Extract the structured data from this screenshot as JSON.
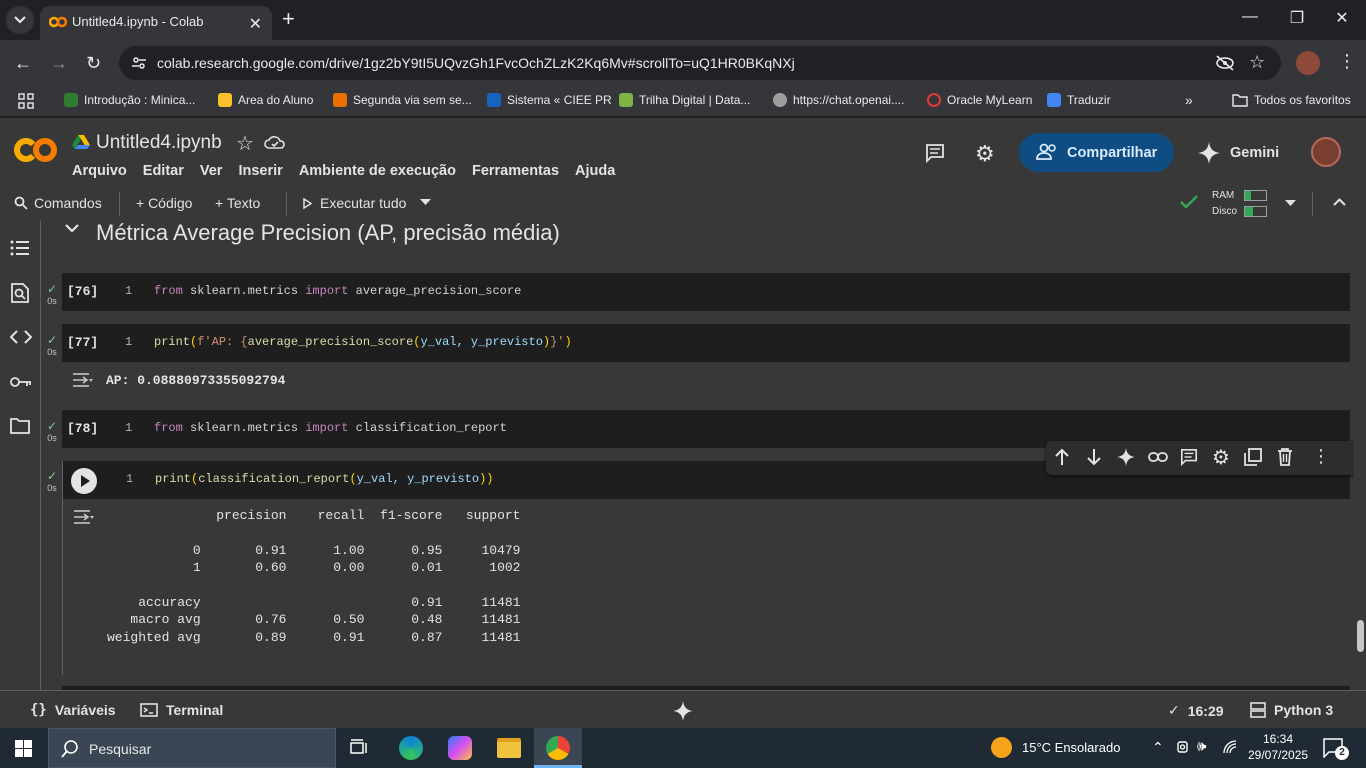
{
  "browser": {
    "tab_title": "Untitled4.ipynb - Colab",
    "url": "colab.research.google.com/drive/1gz2bY9tI5UQvzGh1FvcOchZLzK2Kq6Mv#scrollTo=uQ1HR0BKqNXj",
    "bookmarks": [
      {
        "label": "Introdução : Minica...",
        "color": "#2e7d32"
      },
      {
        "label": "Area do Aluno",
        "color": "#fbc02d"
      },
      {
        "label": "Segunda via sem se...",
        "color": "#ef6c00"
      },
      {
        "label": "Sistema « CIEE PR",
        "color": "#1565c0"
      },
      {
        "label": "Trilha Digital | Data...",
        "color": "#7cb342"
      },
      {
        "label": "https://chat.openai....",
        "color": "#9e9e9e"
      },
      {
        "label": "Oracle MyLearn",
        "color": "#e53935"
      },
      {
        "label": "Traduzir",
        "color": "#4285f4"
      }
    ],
    "all_bookmarks": "Todos os favoritos"
  },
  "colab": {
    "notebook_title": "Untitled4.ipynb",
    "menu": [
      "Arquivo",
      "Editar",
      "Ver",
      "Inserir",
      "Ambiente de execução",
      "Ferramentas",
      "Ajuda"
    ],
    "share_label": "Compartilhar",
    "gemini_label": "Gemini",
    "toolbar": {
      "commands": "Comandos",
      "add_code": "+ Código",
      "add_text": "+ Texto",
      "run_all": "Executar tudo",
      "ram": "RAM",
      "disk": "Disco"
    }
  },
  "notebook": {
    "section_heading": "Métrica Average Precision (AP, precisão média)",
    "cells": [
      {
        "exec": "[76]",
        "line": "1",
        "time": "0s"
      },
      {
        "exec": "[77]",
        "line": "1",
        "time": "0s",
        "output": "AP: 0.08880973355092794"
      },
      {
        "exec": "[78]",
        "line": "1",
        "time": "0s"
      },
      {
        "exec": "",
        "line": "1",
        "time": "0s"
      }
    ],
    "code": {
      "c76": {
        "kw1": "from",
        "mod": " sklearn.metrics ",
        "kw2": "import",
        "name": " average_precision_score"
      },
      "c77": {
        "fn": "print",
        "open": "(",
        "fstr_a": "f'AP: {",
        "call": "average_precision_score",
        "args_open": "(",
        "args": "y_val, y_previsto",
        "args_close": ")",
        "fstr_b": "}'",
        "close": ")"
      },
      "c78": {
        "kw1": "from",
        "mod": " sklearn.metrics ",
        "kw2": "import",
        "name": " classification_report"
      },
      "c79": {
        "fn": "print",
        "open": "(",
        "call": "classification_report",
        "args_open": "(",
        "args": "y_val, y_previsto",
        "args_close": ")",
        "close": ")"
      }
    },
    "report": "              precision    recall  f1-score   support\n\n           0       0.91      1.00      0.95     10479\n           1       0.60      0.00      0.01      1002\n\n    accuracy                           0.91     11481\n   macro avg       0.76      0.50      0.48     11481\nweighted avg       0.89      0.91      0.87     11481"
  },
  "status_bar": {
    "variables": "Variáveis",
    "terminal": "Terminal",
    "time": "16:29",
    "runtime": "Python 3"
  },
  "taskbar": {
    "search_placeholder": "Pesquisar",
    "weather": "15°C  Ensolarado",
    "clock_time": "16:34",
    "clock_date": "29/07/2025",
    "notifications": "2"
  }
}
